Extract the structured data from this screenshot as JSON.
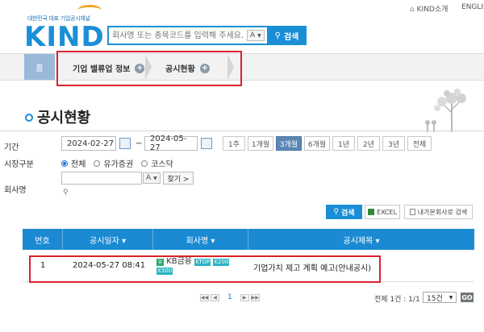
{
  "header": {
    "kind_intro": "KIND소개",
    "english": "ENGLIS",
    "logo_tagline": "대한민국 대표 기업공시채널",
    "logo": "KIND",
    "search_placeholder": "회사명 또는 종목코드를 입력해 주세요.",
    "search_select": "A",
    "search_button": "검색"
  },
  "breadcrumb": {
    "home": "홈",
    "items": [
      "기업 밸류업 정보",
      "공시현황"
    ]
  },
  "page": {
    "title": "공시현황"
  },
  "filters": {
    "period_label": "기간",
    "start_date": "2024-02-27",
    "tilde": "~",
    "end_date": "2024-05-27",
    "periods": [
      "1주",
      "1개월",
      "3개월",
      "6개월",
      "1년",
      "2년",
      "3년",
      "전체"
    ],
    "active_period": "3개월",
    "market_label": "시장구분",
    "markets": [
      "전체",
      "유가증권",
      "코스닥"
    ],
    "selected_market": "전체",
    "company_label": "회사명",
    "company_select": "A",
    "find_button": "찾기 >"
  },
  "actions": {
    "search": "검색",
    "excel": "EXCEL",
    "my_companies": "내가본회사로 검색"
  },
  "table": {
    "columns": [
      "번호",
      "공시일자 ▾",
      "회사명 ▾",
      "공시제목 ▾"
    ],
    "rows": [
      {
        "no": "1",
        "date": "2024-05-27 08:41",
        "market_icon": "유",
        "company": "KB금융",
        "tags": [
          "KTOP",
          "K200",
          "X300"
        ],
        "title": "기업가치 제고 계획 예고(안내공시)"
      }
    ]
  },
  "pager": {
    "current_page": "1",
    "summary": "전체 1건 : 1/1",
    "per_page": "15건",
    "go": "GO"
  },
  "colors": {
    "primary": "#1a8fd6",
    "highlight": "#d9232d",
    "tag": "#29b4c2"
  }
}
